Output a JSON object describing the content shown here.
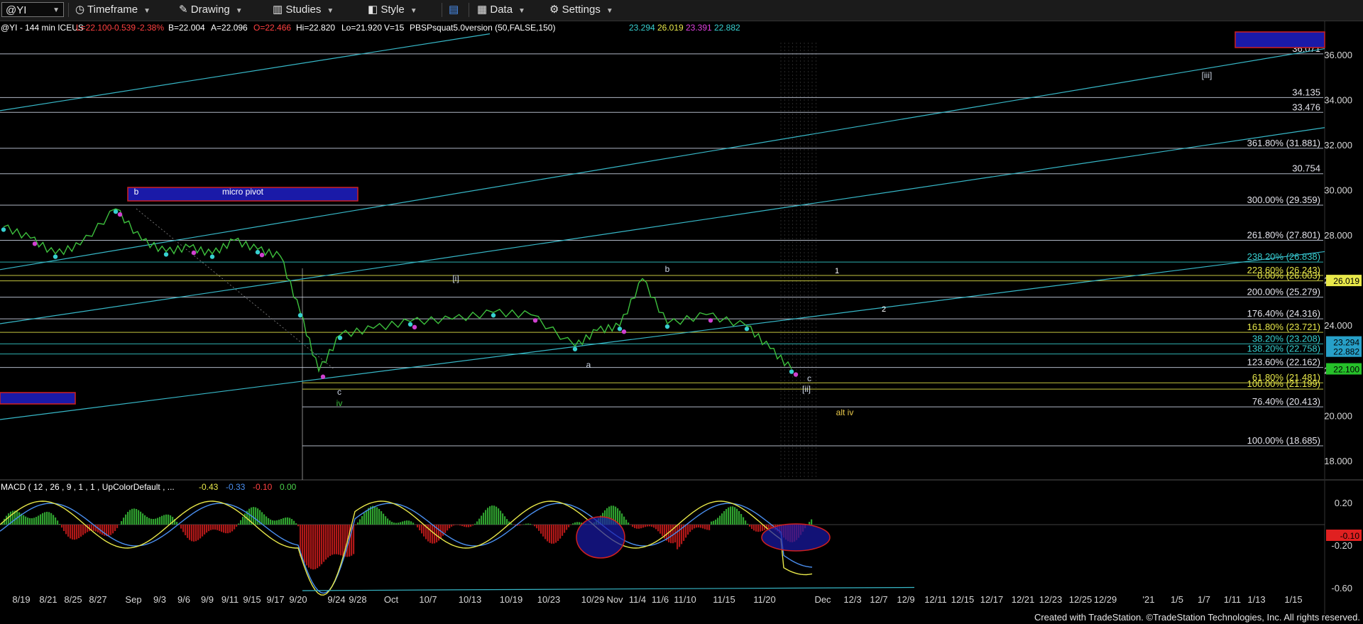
{
  "toolbar": {
    "symbol": "@YI",
    "items": [
      "Timeframe",
      "Drawing",
      "Studies",
      "Style",
      "Data",
      "Settings"
    ]
  },
  "header": {
    "symbol_desc": "@YI - 144 min  ICEUS",
    "L": "L=22.100",
    "chg": "-0.539",
    "pct": "-2.38%",
    "B": "B=22.004",
    "A": "A=22.096",
    "O": "O=22.466",
    "Hi": "Hi=22.820",
    "Lo": "Lo=21.920",
    "V": "V=15",
    "study": "PBSPsquat5.0version (50,FALSE,150)",
    "study_vals": [
      "23.294",
      "26.019",
      "23.391",
      "22.882"
    ],
    "study_colors": [
      "#37d0d0",
      "#e8e84a",
      "#e040e0",
      "#37d0d0"
    ]
  },
  "macd": {
    "label": "MACD ( 12 , 26 , 9 , 1 , 1 , UpColorDefault , ...",
    "vals": [
      "-0.43",
      "-0.33",
      "-0.10",
      "0.00"
    ],
    "val_colors": [
      "#e8e84a",
      "#4a8ff0",
      "#ff4040",
      "#4ad04a"
    ],
    "axis": [
      "0.20",
      "-0.20",
      "-0.60"
    ],
    "current": "-0.10"
  },
  "annotations": {
    "micro_pivot": "micro pivot",
    "b1": "b",
    "i": "[i]",
    "b2": "b",
    "c1": "c",
    "iv": "iv",
    "a": "a",
    "c2": "c",
    "ii": "[ii]",
    "alt_iv": "alt iv",
    "iii": "[iii]",
    "n1": "1",
    "n2": "2"
  },
  "footer": "Created with TradeStation. ©TradeStation Technologies, Inc. All rights reserved.",
  "chart_data": {
    "type": "line",
    "title": "@YI - 144 min ICEUS",
    "xlabel": "",
    "ylabel": "",
    "ylim": [
      17.3,
      37.2
    ],
    "y_ticks": [
      "36.000",
      "34.000",
      "32.000",
      "30.000",
      "28.000",
      "26.000",
      "24.000",
      "22.000",
      "20.000",
      "18.000"
    ],
    "x_ticks": [
      "8/19",
      "8/21",
      "8/25",
      "8/27",
      "Sep",
      "9/3",
      "9/6",
      "9/9",
      "9/11",
      "9/15",
      "9/17",
      "9/20",
      "9/24",
      "9/28",
      "Oct",
      "10/7",
      "10/13",
      "10/19",
      "10/23",
      "10/29",
      "Nov",
      "11/4",
      "11/6",
      "11/10",
      "11/15",
      "11/20",
      "Dec",
      "12/3",
      "12/7",
      "12/9",
      "12/11",
      "12/15",
      "12/17",
      "12/21",
      "12/23",
      "12/25",
      "12/29",
      "'21",
      "1/5",
      "1/7",
      "1/11",
      "1/13",
      "1/15"
    ],
    "price_series": [
      {
        "d": "8/19",
        "v": 28.4
      },
      {
        "d": "8/21",
        "v": 27.9
      },
      {
        "d": "8/25",
        "v": 27.2
      },
      {
        "d": "8/27",
        "v": 27.6
      },
      {
        "d": "Sep",
        "v": 29.2
      },
      {
        "d": "9/3",
        "v": 27.8
      },
      {
        "d": "9/6",
        "v": 27.3
      },
      {
        "d": "9/9",
        "v": 27.5
      },
      {
        "d": "9/11",
        "v": 27.2
      },
      {
        "d": "9/15",
        "v": 27.8
      },
      {
        "d": "9/17",
        "v": 27.4
      },
      {
        "d": "9/20",
        "v": 27.1
      },
      {
        "d": "9/22",
        "v": 24.6
      },
      {
        "d": "9/24",
        "v": 22.0
      },
      {
        "d": "9/28",
        "v": 23.6
      },
      {
        "d": "Oct",
        "v": 23.9
      },
      {
        "d": "10/7",
        "v": 24.2
      },
      {
        "d": "10/13",
        "v": 24.3
      },
      {
        "d": "10/19",
        "v": 24.6
      },
      {
        "d": "10/23",
        "v": 24.5
      },
      {
        "d": "10/29",
        "v": 23.1
      },
      {
        "d": "Nov",
        "v": 23.8
      },
      {
        "d": "11/4",
        "v": 24.0
      },
      {
        "d": "11/6",
        "v": 26.1
      },
      {
        "d": "11/10",
        "v": 24.1
      },
      {
        "d": "11/15",
        "v": 24.5
      },
      {
        "d": "11/20",
        "v": 24.0
      },
      {
        "d": "11/24",
        "v": 23.0
      },
      {
        "d": "11/27",
        "v": 22.1
      }
    ],
    "fib_levels": [
      {
        "label": "36.071",
        "v": 36.071,
        "color": "#cfd8e8",
        "style": "line"
      },
      {
        "label": "34.135",
        "v": 34.135,
        "color": "#cfd8e8"
      },
      {
        "label": "33.476",
        "v": 33.476,
        "color": "#cfd8e8"
      },
      {
        "label": "361.80% (31.881)",
        "v": 31.881,
        "color": "#cfd8e8"
      },
      {
        "label": "30.754",
        "v": 30.754,
        "color": "#cfd8e8"
      },
      {
        "label": "300.00% (29.359)",
        "v": 29.359,
        "color": "#cfd8e8"
      },
      {
        "label": "261.80% (27.801)",
        "v": 27.801,
        "color": "#cfd8e8"
      },
      {
        "label": "238.20% (26.838)",
        "v": 26.838,
        "color": "#37d0d0"
      },
      {
        "label": "223.60% (26.243)",
        "v": 26.243,
        "color": "#e8e84a"
      },
      {
        "label": "0.00% (26.003)",
        "v": 26.003,
        "color": "#e8e84a"
      },
      {
        "label": "200.00% (25.279)",
        "v": 25.279,
        "color": "#cfd8e8"
      },
      {
        "label": "176.40% (24.316)",
        "v": 24.316,
        "color": "#cfd8e8"
      },
      {
        "label": "161.80% (23.721)",
        "v": 23.721,
        "color": "#e8e84a"
      },
      {
        "label": "38.20% (23.208)",
        "v": 23.208,
        "color": "#37d0d0"
      },
      {
        "label": "138.20% (22.758)",
        "v": 22.758,
        "color": "#37d0d0"
      },
      {
        "label": "123.60% (22.162)",
        "v": 22.162,
        "color": "#cfd8e8"
      },
      {
        "label": "61.80% (21.481)",
        "v": 21.481,
        "color": "#e8e84a"
      },
      {
        "label": "100.00% (21.199)",
        "v": 21.199,
        "color": "#e8e84a"
      },
      {
        "label": "76.40% (20.413)",
        "v": 20.413,
        "color": "#cfd8e8"
      },
      {
        "label": "100.00% (18.685)",
        "v": 18.685,
        "color": "#cfd8e8"
      }
    ],
    "price_tags": [
      {
        "label": "26.019",
        "v": 26.019,
        "bg": "#e8e84a",
        "fg": "#000"
      },
      {
        "label": "23.294",
        "v": 23.294,
        "bg": "#27a0c8",
        "fg": "#000"
      },
      {
        "label": "22.882",
        "v": 22.882,
        "bg": "#27a0c8",
        "fg": "#000"
      },
      {
        "label": "22.100",
        "v": 22.1,
        "bg": "#26c02a",
        "fg": "#000"
      }
    ]
  }
}
